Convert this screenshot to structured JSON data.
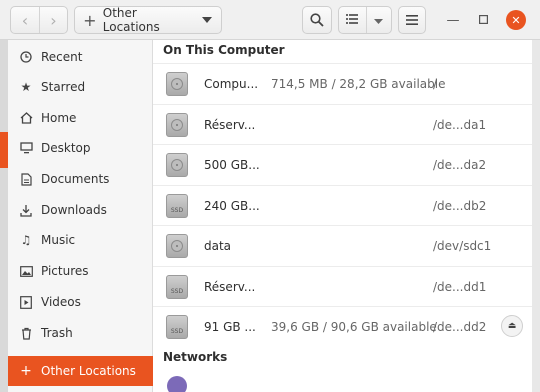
{
  "header": {
    "location_label": "Other Locations",
    "icons": {
      "back": "chevron-left-icon",
      "forward": "chevron-right-icon",
      "add": "plus-icon",
      "dropdown": "caret-down-icon",
      "search": "search-icon",
      "list_view": "list-view-icon",
      "view_options": "caret-down-icon",
      "menu": "hamburger-menu-icon",
      "minimize": "minimize-icon",
      "maximize": "maximize-icon",
      "close": "close-icon"
    }
  },
  "sidebar": {
    "items": [
      {
        "label": "Recent",
        "icon": "clock-icon"
      },
      {
        "label": "Starred",
        "icon": "star-icon"
      },
      {
        "label": "Home",
        "icon": "home-icon"
      },
      {
        "label": "Desktop",
        "icon": "desktop-icon"
      },
      {
        "label": "Documents",
        "icon": "document-icon"
      },
      {
        "label": "Downloads",
        "icon": "download-icon"
      },
      {
        "label": "Music",
        "icon": "music-icon"
      },
      {
        "label": "Pictures",
        "icon": "picture-icon"
      },
      {
        "label": "Videos",
        "icon": "video-icon"
      },
      {
        "label": "Trash",
        "icon": "trash-icon"
      },
      {
        "label": "Other Locations",
        "icon": "plus-icon",
        "active": true
      }
    ]
  },
  "main": {
    "sections": {
      "computer": "On This Computer",
      "networks": "Networks"
    },
    "drives": [
      {
        "name": "Compu...",
        "space": "714,5 MB / 28,2 GB available",
        "path": "/",
        "type": "hdd"
      },
      {
        "name": "Réserv...",
        "space": "",
        "path": "/de...da1",
        "type": "hdd"
      },
      {
        "name": "500 GB...",
        "space": "",
        "path": "/de...da2",
        "type": "hdd"
      },
      {
        "name": "240 GB...",
        "space": "",
        "path": "/de...db2",
        "type": "ssd"
      },
      {
        "name": "data",
        "space": "",
        "path": "/dev/sdc1",
        "type": "hdd"
      },
      {
        "name": "Réserv...",
        "space": "",
        "path": "/de...dd1",
        "type": "ssd"
      },
      {
        "name": "91 GB ...",
        "space": "39,6 GB / 90,6 GB available",
        "path": "/de...dd2",
        "type": "ssd",
        "eject": true
      }
    ],
    "ssd_label": "SSD"
  },
  "colors": {
    "accent": "#e95420",
    "sidebar_bg": "#f6f6f6",
    "header_bg": "#f0f0f0"
  }
}
